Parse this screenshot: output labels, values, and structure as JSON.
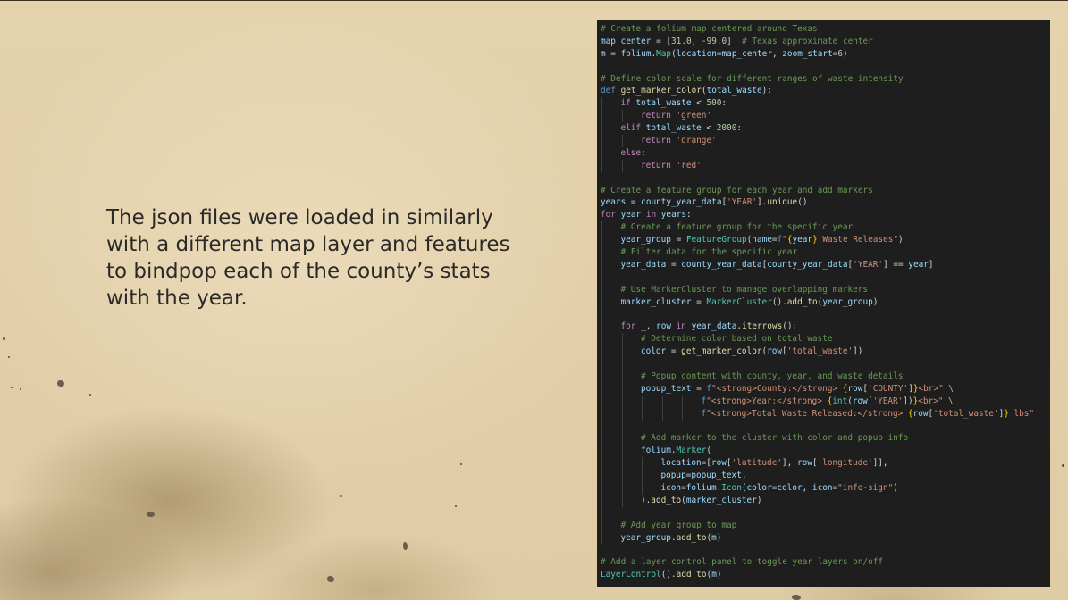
{
  "description": "The json files were loaded in similarly with a different map layer and features to bindpop each of the county’s stats with the year.",
  "colors": {
    "background": "#e2cfa9",
    "text": "#2b2a28",
    "code_background": "#1e1e1e"
  },
  "code_lines": [
    {
      "indent": 0,
      "tokens": [
        [
          "comment",
          "# Create a folium map centered around Texas"
        ]
      ]
    },
    {
      "indent": 0,
      "tokens": [
        [
          "var",
          "map_center"
        ],
        [
          "plain",
          " = ["
        ],
        [
          "number",
          "31.0"
        ],
        [
          "plain",
          ", "
        ],
        [
          "number",
          "-99.0"
        ],
        [
          "plain",
          "]  "
        ],
        [
          "comment",
          "# Texas approximate center"
        ]
      ]
    },
    {
      "indent": 0,
      "tokens": [
        [
          "var",
          "m"
        ],
        [
          "plain",
          " = "
        ],
        [
          "var",
          "folium"
        ],
        [
          "plain",
          "."
        ],
        [
          "class",
          "Map"
        ],
        [
          "plain",
          "("
        ],
        [
          "var",
          "location"
        ],
        [
          "plain",
          "="
        ],
        [
          "var",
          "map_center"
        ],
        [
          "plain",
          ", "
        ],
        [
          "var",
          "zoom_start"
        ],
        [
          "plain",
          "="
        ],
        [
          "number",
          "6"
        ],
        [
          "plain",
          ")"
        ]
      ]
    },
    {
      "indent": 0,
      "tokens": []
    },
    {
      "indent": 0,
      "tokens": [
        [
          "comment",
          "# Define color scale for different ranges of waste intensity"
        ]
      ]
    },
    {
      "indent": 0,
      "tokens": [
        [
          "keyword",
          "def"
        ],
        [
          "plain",
          " "
        ],
        [
          "func",
          "get_marker_color"
        ],
        [
          "plain",
          "("
        ],
        [
          "var",
          "total_waste"
        ],
        [
          "plain",
          "):"
        ]
      ]
    },
    {
      "indent": 1,
      "tokens": [
        [
          "control",
          "if"
        ],
        [
          "plain",
          " "
        ],
        [
          "var",
          "total_waste"
        ],
        [
          "plain",
          " < "
        ],
        [
          "number",
          "500"
        ],
        [
          "plain",
          ":"
        ]
      ]
    },
    {
      "indent": 2,
      "tokens": [
        [
          "control",
          "return"
        ],
        [
          "plain",
          " "
        ],
        [
          "string",
          "'green'"
        ]
      ]
    },
    {
      "indent": 1,
      "tokens": [
        [
          "control",
          "elif"
        ],
        [
          "plain",
          " "
        ],
        [
          "var",
          "total_waste"
        ],
        [
          "plain",
          " < "
        ],
        [
          "number",
          "2000"
        ],
        [
          "plain",
          ":"
        ]
      ]
    },
    {
      "indent": 2,
      "tokens": [
        [
          "control",
          "return"
        ],
        [
          "plain",
          " "
        ],
        [
          "string",
          "'orange'"
        ]
      ]
    },
    {
      "indent": 1,
      "tokens": [
        [
          "control",
          "else"
        ],
        [
          "plain",
          ":"
        ]
      ]
    },
    {
      "indent": 2,
      "tokens": [
        [
          "control",
          "return"
        ],
        [
          "plain",
          " "
        ],
        [
          "string",
          "'red'"
        ]
      ]
    },
    {
      "indent": 0,
      "tokens": []
    },
    {
      "indent": 0,
      "tokens": [
        [
          "comment",
          "# Create a feature group for each year and add markers"
        ]
      ]
    },
    {
      "indent": 0,
      "tokens": [
        [
          "var",
          "years"
        ],
        [
          "plain",
          " = "
        ],
        [
          "var",
          "county_year_data"
        ],
        [
          "plain",
          "["
        ],
        [
          "string",
          "'YEAR'"
        ],
        [
          "plain",
          "]."
        ],
        [
          "func",
          "unique"
        ],
        [
          "plain",
          "()"
        ]
      ]
    },
    {
      "indent": 0,
      "tokens": [
        [
          "control",
          "for"
        ],
        [
          "plain",
          " "
        ],
        [
          "var",
          "year"
        ],
        [
          "plain",
          " "
        ],
        [
          "control",
          "in"
        ],
        [
          "plain",
          " "
        ],
        [
          "var",
          "years"
        ],
        [
          "plain",
          ":"
        ]
      ]
    },
    {
      "indent": 1,
      "tokens": [
        [
          "comment",
          "# Create a feature group for the specific year"
        ]
      ]
    },
    {
      "indent": 1,
      "tokens": [
        [
          "var",
          "year_group"
        ],
        [
          "plain",
          " = "
        ],
        [
          "class",
          "FeatureGroup"
        ],
        [
          "plain",
          "("
        ],
        [
          "var",
          "name"
        ],
        [
          "plain",
          "="
        ],
        [
          "keyword",
          "f"
        ],
        [
          "string",
          "\""
        ],
        [
          "brace",
          "{"
        ],
        [
          "var",
          "year"
        ],
        [
          "brace",
          "}"
        ],
        [
          "string",
          " Waste Releases\""
        ],
        [
          "plain",
          ")"
        ]
      ]
    },
    {
      "indent": 1,
      "tokens": [
        [
          "comment",
          "# Filter data for the specific year"
        ]
      ]
    },
    {
      "indent": 1,
      "tokens": [
        [
          "var",
          "year_data"
        ],
        [
          "plain",
          " = "
        ],
        [
          "var",
          "county_year_data"
        ],
        [
          "plain",
          "["
        ],
        [
          "var",
          "county_year_data"
        ],
        [
          "plain",
          "["
        ],
        [
          "string",
          "'YEAR'"
        ],
        [
          "plain",
          "] == "
        ],
        [
          "var",
          "year"
        ],
        [
          "plain",
          "]"
        ]
      ]
    },
    {
      "indent": 1,
      "tokens": []
    },
    {
      "indent": 1,
      "tokens": [
        [
          "comment",
          "# Use MarkerCluster to manage overlapping markers"
        ]
      ]
    },
    {
      "indent": 1,
      "tokens": [
        [
          "var",
          "marker_cluster"
        ],
        [
          "plain",
          " = "
        ],
        [
          "class",
          "MarkerCluster"
        ],
        [
          "plain",
          "()."
        ],
        [
          "func",
          "add_to"
        ],
        [
          "plain",
          "("
        ],
        [
          "var",
          "year_group"
        ],
        [
          "plain",
          ")"
        ]
      ]
    },
    {
      "indent": 1,
      "tokens": []
    },
    {
      "indent": 1,
      "tokens": [
        [
          "control",
          "for"
        ],
        [
          "plain",
          " "
        ],
        [
          "var",
          "_"
        ],
        [
          "plain",
          ", "
        ],
        [
          "var",
          "row"
        ],
        [
          "plain",
          " "
        ],
        [
          "control",
          "in"
        ],
        [
          "plain",
          " "
        ],
        [
          "var",
          "year_data"
        ],
        [
          "plain",
          "."
        ],
        [
          "func",
          "iterrows"
        ],
        [
          "plain",
          "():"
        ]
      ]
    },
    {
      "indent": 2,
      "tokens": [
        [
          "comment",
          "# Determine color based on total waste"
        ]
      ]
    },
    {
      "indent": 2,
      "tokens": [
        [
          "var",
          "color"
        ],
        [
          "plain",
          " = "
        ],
        [
          "func",
          "get_marker_color"
        ],
        [
          "plain",
          "("
        ],
        [
          "var",
          "row"
        ],
        [
          "plain",
          "["
        ],
        [
          "string",
          "'total_waste'"
        ],
        [
          "plain",
          "])"
        ]
      ]
    },
    {
      "indent": 2,
      "tokens": []
    },
    {
      "indent": 2,
      "tokens": [
        [
          "comment",
          "# Popup content with county, year, and waste details"
        ]
      ]
    },
    {
      "indent": 2,
      "tokens": [
        [
          "var",
          "popup_text"
        ],
        [
          "plain",
          " = "
        ],
        [
          "keyword",
          "f"
        ],
        [
          "string",
          "\"<strong>County:</strong> "
        ],
        [
          "brace",
          "{"
        ],
        [
          "var",
          "row"
        ],
        [
          "plain",
          "["
        ],
        [
          "string",
          "'COUNTY'"
        ],
        [
          "plain",
          "]"
        ],
        [
          "brace",
          "}"
        ],
        [
          "string",
          "<br>\" "
        ],
        [
          "esc",
          "\\"
        ]
      ]
    },
    {
      "indent": 5,
      "tokens": [
        [
          "keyword",
          "f"
        ],
        [
          "string",
          "\"<strong>Year:</strong> "
        ],
        [
          "brace",
          "{"
        ],
        [
          "class",
          "int"
        ],
        [
          "plain",
          "("
        ],
        [
          "var",
          "row"
        ],
        [
          "plain",
          "["
        ],
        [
          "string",
          "'YEAR'"
        ],
        [
          "plain",
          "])"
        ],
        [
          "brace",
          "}"
        ],
        [
          "string",
          "<br>\" "
        ],
        [
          "esc",
          "\\"
        ]
      ]
    },
    {
      "indent": 5,
      "tokens": [
        [
          "keyword",
          "f"
        ],
        [
          "string",
          "\"<strong>Total Waste Released:</strong> "
        ],
        [
          "brace",
          "{"
        ],
        [
          "var",
          "row"
        ],
        [
          "plain",
          "["
        ],
        [
          "string",
          "'total_waste'"
        ],
        [
          "plain",
          "]"
        ],
        [
          "brace",
          "}"
        ],
        [
          "string",
          " lbs\""
        ]
      ]
    },
    {
      "indent": 2,
      "tokens": []
    },
    {
      "indent": 2,
      "tokens": [
        [
          "comment",
          "# Add marker to the cluster with color and popup info"
        ]
      ]
    },
    {
      "indent": 2,
      "tokens": [
        [
          "var",
          "folium"
        ],
        [
          "plain",
          "."
        ],
        [
          "class",
          "Marker"
        ],
        [
          "plain",
          "("
        ]
      ]
    },
    {
      "indent": 3,
      "tokens": [
        [
          "var",
          "location"
        ],
        [
          "plain",
          "=["
        ],
        [
          "var",
          "row"
        ],
        [
          "plain",
          "["
        ],
        [
          "string",
          "'latitude'"
        ],
        [
          "plain",
          "], "
        ],
        [
          "var",
          "row"
        ],
        [
          "plain",
          "["
        ],
        [
          "string",
          "'longitude'"
        ],
        [
          "plain",
          "]],"
        ]
      ]
    },
    {
      "indent": 3,
      "tokens": [
        [
          "var",
          "popup"
        ],
        [
          "plain",
          "="
        ],
        [
          "var",
          "popup_text"
        ],
        [
          "plain",
          ","
        ]
      ]
    },
    {
      "indent": 3,
      "tokens": [
        [
          "var",
          "icon"
        ],
        [
          "plain",
          "="
        ],
        [
          "var",
          "folium"
        ],
        [
          "plain",
          "."
        ],
        [
          "class",
          "Icon"
        ],
        [
          "plain",
          "("
        ],
        [
          "var",
          "color"
        ],
        [
          "plain",
          "="
        ],
        [
          "var",
          "color"
        ],
        [
          "plain",
          ", "
        ],
        [
          "var",
          "icon"
        ],
        [
          "plain",
          "="
        ],
        [
          "string",
          "\"info-sign\""
        ],
        [
          "plain",
          ")"
        ]
      ]
    },
    {
      "indent": 2,
      "tokens": [
        [
          "plain",
          ")."
        ],
        [
          "func",
          "add_to"
        ],
        [
          "plain",
          "("
        ],
        [
          "var",
          "marker_cluster"
        ],
        [
          "plain",
          ")"
        ]
      ]
    },
    {
      "indent": 1,
      "tokens": []
    },
    {
      "indent": 1,
      "tokens": [
        [
          "comment",
          "# Add year group to map"
        ]
      ]
    },
    {
      "indent": 1,
      "tokens": [
        [
          "var",
          "year_group"
        ],
        [
          "plain",
          "."
        ],
        [
          "func",
          "add_to"
        ],
        [
          "plain",
          "("
        ],
        [
          "var",
          "m"
        ],
        [
          "plain",
          ")"
        ]
      ]
    },
    {
      "indent": 0,
      "tokens": []
    },
    {
      "indent": 0,
      "tokens": [
        [
          "comment",
          "# Add a layer control panel to toggle year layers on/off"
        ]
      ]
    },
    {
      "indent": 0,
      "tokens": [
        [
          "class",
          "LayerControl"
        ],
        [
          "plain",
          "()."
        ],
        [
          "func",
          "add_to"
        ],
        [
          "plain",
          "("
        ],
        [
          "var",
          "m"
        ],
        [
          "plain",
          ")"
        ]
      ]
    }
  ]
}
